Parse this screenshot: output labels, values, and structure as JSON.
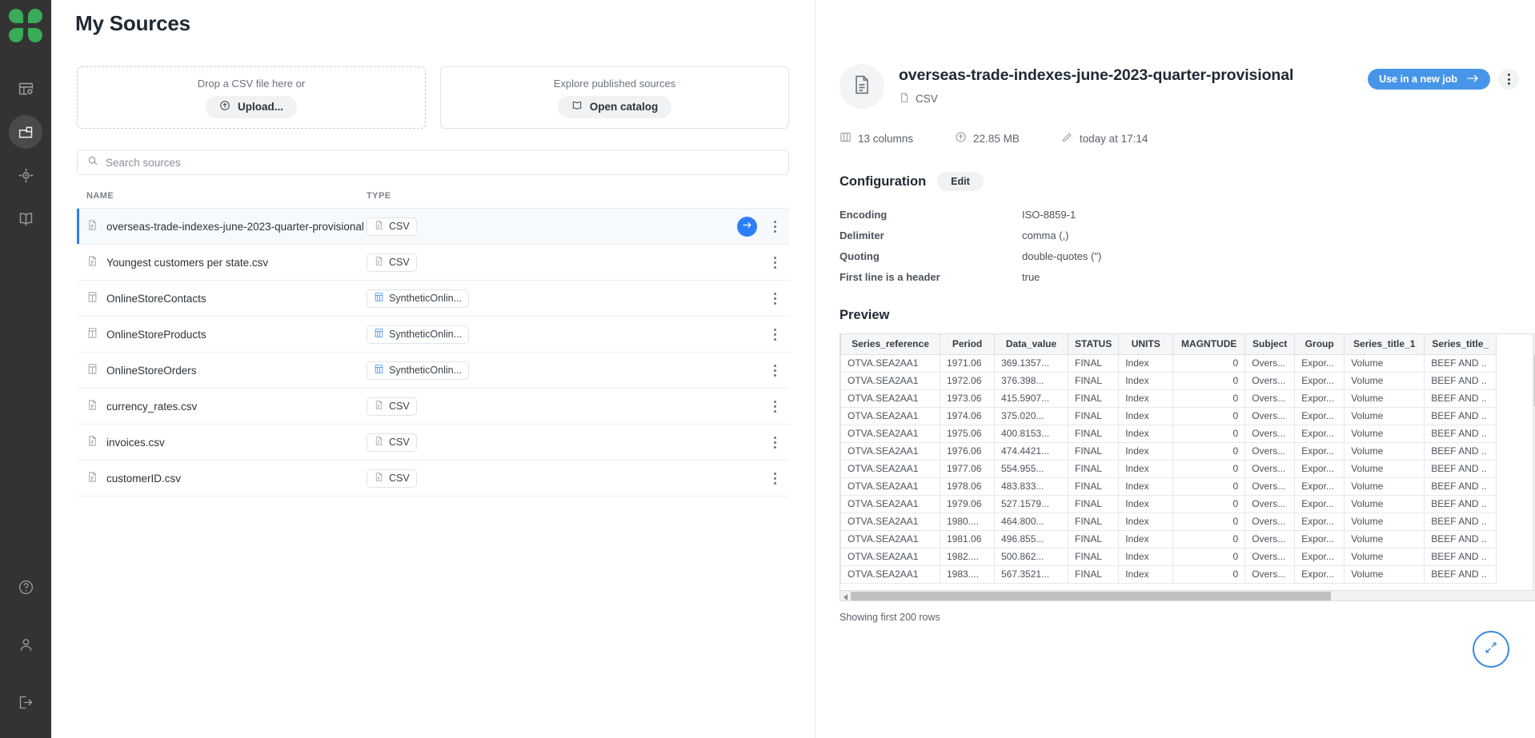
{
  "sidebar": {
    "logo_name": "clover-logo",
    "items": [
      {
        "icon": "table-remove-icon",
        "name": "sidebar-item-datasets",
        "active": false
      },
      {
        "icon": "folder-icon",
        "name": "sidebar-item-sources",
        "active": true
      },
      {
        "icon": "target-icon",
        "name": "sidebar-item-targets",
        "active": false
      },
      {
        "icon": "book-icon",
        "name": "sidebar-item-catalog",
        "active": false
      }
    ],
    "bottom_items": [
      {
        "icon": "help-icon",
        "name": "sidebar-item-help"
      },
      {
        "icon": "user-icon",
        "name": "sidebar-item-account"
      },
      {
        "icon": "logout-icon",
        "name": "sidebar-item-logout"
      }
    ]
  },
  "page": {
    "title": "My Sources"
  },
  "upload_card": {
    "caption": "Drop a CSV file here or",
    "button_label": "Upload...",
    "button_icon": "upload-arrow-icon"
  },
  "catalog_card": {
    "caption": "Explore published sources",
    "button_label": "Open catalog",
    "button_icon": "book-icon"
  },
  "search": {
    "placeholder": "Search sources",
    "value": "",
    "icon": "search-icon"
  },
  "list": {
    "columns": [
      "NAME",
      "TYPE"
    ],
    "rows": [
      {
        "name": "overseas-trade-indexes-june-2023-quarter-provisional",
        "type": "CSV",
        "icon": "csv-file-icon",
        "type_icon": "csv-file-icon",
        "selected": true,
        "has_go": true
      },
      {
        "name": "Youngest customers per state.csv",
        "type": "CSV",
        "icon": "csv-file-icon",
        "type_icon": "csv-file-icon",
        "selected": false,
        "has_go": false
      },
      {
        "name": "OnlineStoreContacts",
        "type": "SyntheticOnlin...",
        "icon": "db-table-icon",
        "type_icon": "synthetic-db-icon",
        "selected": false,
        "has_go": false
      },
      {
        "name": "OnlineStoreProducts",
        "type": "SyntheticOnlin...",
        "icon": "db-table-icon",
        "type_icon": "synthetic-db-icon",
        "selected": false,
        "has_go": false
      },
      {
        "name": "OnlineStoreOrders",
        "type": "SyntheticOnlin...",
        "icon": "db-table-icon",
        "type_icon": "synthetic-db-icon",
        "selected": false,
        "has_go": false
      },
      {
        "name": "currency_rates.csv",
        "type": "CSV",
        "icon": "csv-file-icon",
        "type_icon": "csv-file-icon",
        "selected": false,
        "has_go": false
      },
      {
        "name": "invoices.csv",
        "type": "CSV",
        "icon": "csv-file-icon",
        "type_icon": "csv-file-icon",
        "selected": false,
        "has_go": false
      },
      {
        "name": "customerID.csv",
        "type": "CSV",
        "icon": "csv-file-icon",
        "type_icon": "csv-file-icon",
        "selected": false,
        "has_go": false
      }
    ]
  },
  "detail": {
    "title": "overseas-trade-indexes-june-2023-quarter-provisional",
    "format": "CSV",
    "primary_button": "Use in a new job",
    "meta": [
      {
        "icon": "columns-icon",
        "text": "13 columns"
      },
      {
        "icon": "size-icon",
        "text": "22.85 MB"
      },
      {
        "icon": "pencil-icon",
        "text": "today at 17:14"
      }
    ]
  },
  "configuration": {
    "title": "Configuration",
    "edit_label": "Edit",
    "entries": [
      {
        "key": "Encoding",
        "value": "ISO-8859-1"
      },
      {
        "key": "Delimiter",
        "value": "comma (,)"
      },
      {
        "key": "Quoting",
        "value": "double-quotes (\")"
      },
      {
        "key": "First line is a header",
        "value": "true"
      }
    ]
  },
  "preview": {
    "title": "Preview",
    "footer": "Showing first 200 rows",
    "columns": [
      "Series_reference",
      "Period",
      "Data_value",
      "STATUS",
      "UNITS",
      "MAGNTUDE",
      "Subject",
      "Group",
      "Series_title_1",
      "Series_title_"
    ],
    "rows": [
      [
        "OTVA.SEA2AA1",
        "1971.06",
        "369.1357...",
        "FINAL",
        "Index",
        "0",
        "Overs...",
        "Expor...",
        "Volume",
        "BEEF AND .."
      ],
      [
        "OTVA.SEA2AA1",
        "1972.06",
        "376.398...",
        "FINAL",
        "Index",
        "0",
        "Overs...",
        "Expor...",
        "Volume",
        "BEEF AND .."
      ],
      [
        "OTVA.SEA2AA1",
        "1973.06",
        "415.5907...",
        "FINAL",
        "Index",
        "0",
        "Overs...",
        "Expor...",
        "Volume",
        "BEEF AND .."
      ],
      [
        "OTVA.SEA2AA1",
        "1974.06",
        "375.020...",
        "FINAL",
        "Index",
        "0",
        "Overs...",
        "Expor...",
        "Volume",
        "BEEF AND .."
      ],
      [
        "OTVA.SEA2AA1",
        "1975.06",
        "400.8153...",
        "FINAL",
        "Index",
        "0",
        "Overs...",
        "Expor...",
        "Volume",
        "BEEF AND .."
      ],
      [
        "OTVA.SEA2AA1",
        "1976.06",
        "474.4421...",
        "FINAL",
        "Index",
        "0",
        "Overs...",
        "Expor...",
        "Volume",
        "BEEF AND .."
      ],
      [
        "OTVA.SEA2AA1",
        "1977.06",
        "554.955...",
        "FINAL",
        "Index",
        "0",
        "Overs...",
        "Expor...",
        "Volume",
        "BEEF AND .."
      ],
      [
        "OTVA.SEA2AA1",
        "1978.06",
        "483.833...",
        "FINAL",
        "Index",
        "0",
        "Overs...",
        "Expor...",
        "Volume",
        "BEEF AND .."
      ],
      [
        "OTVA.SEA2AA1",
        "1979.06",
        "527.1579...",
        "FINAL",
        "Index",
        "0",
        "Overs...",
        "Expor...",
        "Volume",
        "BEEF AND .."
      ],
      [
        "OTVA.SEA2AA1",
        "1980....",
        "464.800...",
        "FINAL",
        "Index",
        "0",
        "Overs...",
        "Expor...",
        "Volume",
        "BEEF AND .."
      ],
      [
        "OTVA.SEA2AA1",
        "1981.06",
        "496.855...",
        "FINAL",
        "Index",
        "0",
        "Overs...",
        "Expor...",
        "Volume",
        "BEEF AND .."
      ],
      [
        "OTVA.SEA2AA1",
        "1982....",
        "500.862...",
        "FINAL",
        "Index",
        "0",
        "Overs...",
        "Expor...",
        "Volume",
        "BEEF AND .."
      ],
      [
        "OTVA.SEA2AA1",
        "1983....",
        "567.3521...",
        "FINAL",
        "Index",
        "0",
        "Overs...",
        "Expor...",
        "Volume",
        "BEEF AND .."
      ]
    ]
  },
  "fab": {
    "icon": "expand-icon"
  },
  "colors": {
    "accent": "#2d7ff9",
    "brand_green": "#3aab58",
    "sidebar_bg": "#333333"
  }
}
